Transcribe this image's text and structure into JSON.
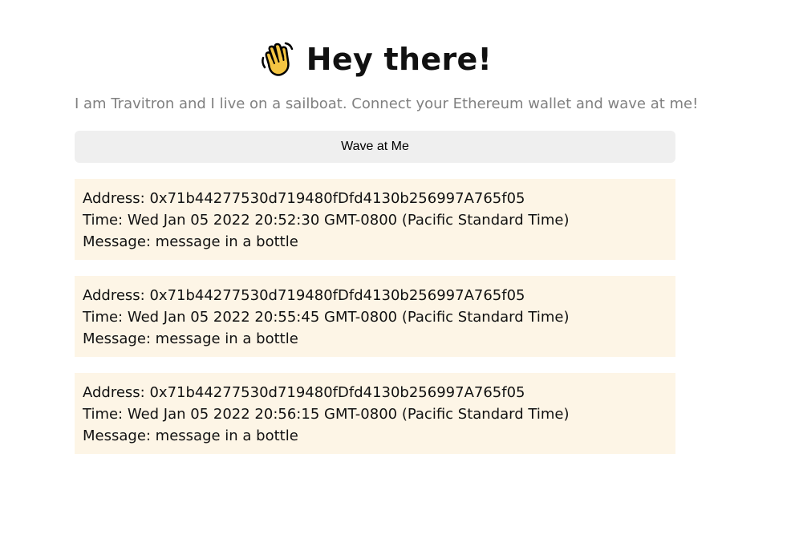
{
  "header": {
    "icon": "waving-hand-icon",
    "title": "Hey there!"
  },
  "bio": "I am Travitron and I live on a sailboat. Connect your Ethereum wallet and wave at me!",
  "wave_button": {
    "label": "Wave at Me"
  },
  "waves": [
    {
      "address_label": "Address: 0x71b44277530d719480fDfd4130b256997A765f05",
      "time_label": "Time: Wed Jan 05 2022 20:52:30 GMT-0800 (Pacific Standard Time)",
      "message_label": "Message: message in a bottle"
    },
    {
      "address_label": "Address: 0x71b44277530d719480fDfd4130b256997A765f05",
      "time_label": "Time: Wed Jan 05 2022 20:55:45 GMT-0800 (Pacific Standard Time)",
      "message_label": "Message: message in a bottle"
    },
    {
      "address_label": "Address: 0x71b44277530d719480fDfd4130b256997A765f05",
      "time_label": "Time: Wed Jan 05 2022 20:56:15 GMT-0800 (Pacific Standard Time)",
      "message_label": "Message: message in a bottle"
    }
  ],
  "colors": {
    "card_background": "#fdf5e6",
    "button_background": "#efefef",
    "bio_text": "#808080"
  }
}
